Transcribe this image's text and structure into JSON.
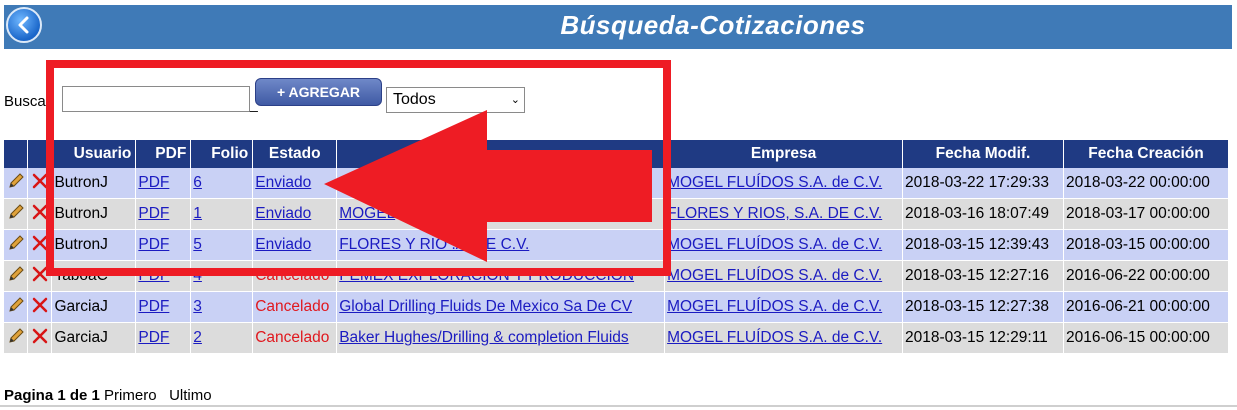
{
  "header": {
    "title": "Búsqueda-Cotizaciones",
    "back_icon": "back-arrow-icon"
  },
  "toolbar": {
    "search_label": "Buscar:",
    "search_value": "",
    "add_label": "+ AGREGAR",
    "status_selected": "Todos"
  },
  "table": {
    "headers": [
      "Usuario",
      "PDF",
      "Folio",
      "Estado",
      "Empresa",
      "Fecha Modif.",
      "Fecha Creación"
    ],
    "rows": [
      {
        "usuario": "ButronJ",
        "pdf": "PDF",
        "folio": "6",
        "estado": "Enviado",
        "cliente": "",
        "empresa": "MOGEL FLUÍDOS S.A. de C.V.",
        "fecha_modif": "2018-03-22 17:29:33",
        "fecha_creacion": "2018-03-22 00:00:00"
      },
      {
        "usuario": "ButronJ",
        "pdf": "PDF",
        "folio": "1",
        "estado": "Enviado",
        "cliente": "MOGEL",
        "empresa": "FLORES Y RIOS, S.A. DE C.V.",
        "fecha_modif": "2018-03-16 18:07:49",
        "fecha_creacion": "2018-03-17 00:00:00"
      },
      {
        "usuario": "ButronJ",
        "pdf": "PDF",
        "folio": "5",
        "estado": "Enviado",
        "cliente": "FLORES Y RIO  .A. DE C.V.",
        "empresa": "MOGEL FLUÍDOS S.A. de C.V.",
        "fecha_modif": "2018-03-15 12:39:43",
        "fecha_creacion": "2018-03-15 00:00:00"
      },
      {
        "usuario": "TaboaC",
        "pdf": "PDF",
        "folio": "4",
        "estado": "Cancelado",
        "cliente": "PEMEX EXPLORACION Y PRODUCCION",
        "empresa": "MOGEL FLUÍDOS S.A. de C.V.",
        "fecha_modif": "2018-03-15 12:27:16",
        "fecha_creacion": "2016-06-22 00:00:00"
      },
      {
        "usuario": "GarciaJ",
        "pdf": "PDF",
        "folio": "3",
        "estado": "Cancelado",
        "cliente": "Global Drilling Fluids De Mexico Sa De CV",
        "empresa": "MOGEL FLUÍDOS S.A. de C.V.",
        "fecha_modif": "2018-03-15 12:27:38",
        "fecha_creacion": "2016-06-21 00:00:00"
      },
      {
        "usuario": "GarciaJ",
        "pdf": "PDF",
        "folio": "2",
        "estado": "Cancelado",
        "cliente": "Baker Hughes/Drilling & completion Fluids",
        "empresa": "MOGEL FLUÍDOS S.A. de C.V.",
        "fecha_modif": "2018-03-15 12:29:11",
        "fecha_creacion": "2016-06-15 00:00:00"
      }
    ]
  },
  "footer": {
    "page_info": "Pagina 1 de 1",
    "first": "Primero",
    "last": "Ultimo"
  },
  "colors": {
    "header_bg": "#3f7ab7",
    "table_header_bg": "#1f3a83",
    "annotation_red": "#ee1c24",
    "link": "#1b1bc1",
    "cancelled": "#e0181e"
  }
}
